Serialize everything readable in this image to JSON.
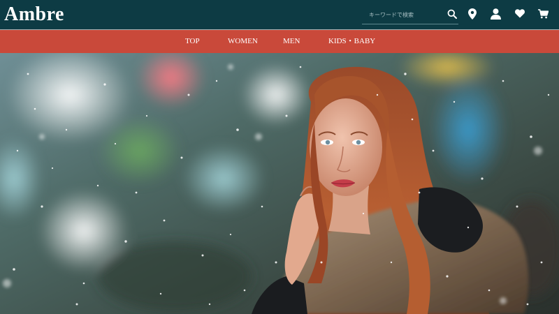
{
  "header": {
    "logo": "Ambre",
    "search": {
      "placeholder": "キーワードで検索",
      "value": ""
    },
    "icons": [
      "search-icon",
      "map-pin-icon",
      "user-icon",
      "heart-icon",
      "cart-icon"
    ]
  },
  "nav": {
    "items": [
      {
        "label": "TOP"
      },
      {
        "label": "WOMEN"
      },
      {
        "label": "MEN"
      },
      {
        "label": "KIDS・BABY"
      }
    ]
  },
  "hero": {
    "image": "woman-in-snow-photo"
  },
  "colors": {
    "header_bg": "#0d3b44",
    "nav_bg": "#c9493a",
    "text": "#ffffff"
  }
}
